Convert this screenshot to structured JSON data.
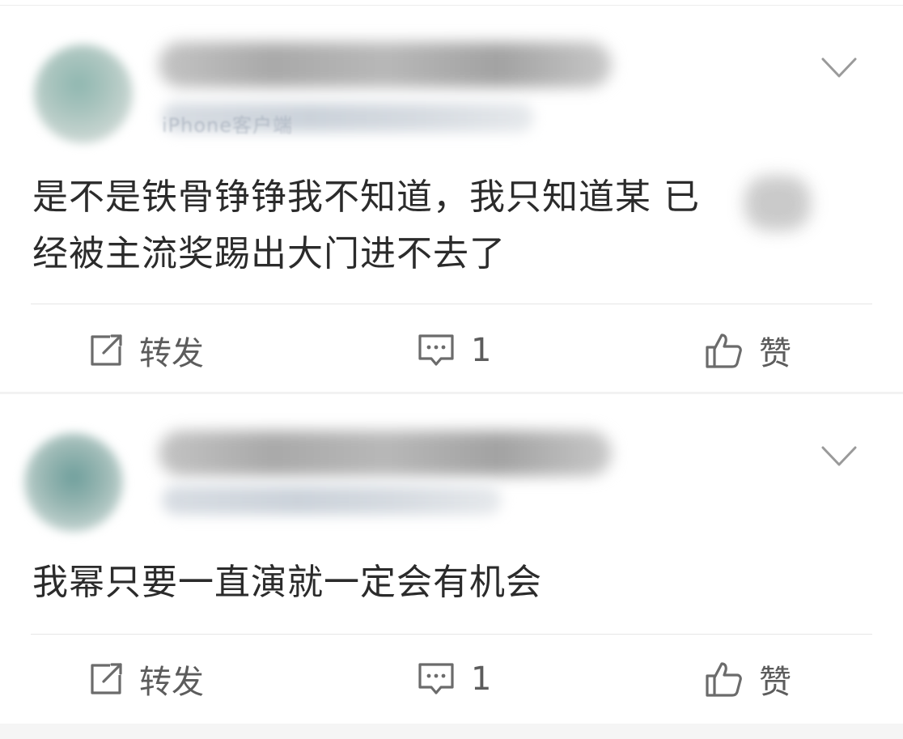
{
  "posts": [
    {
      "meta_visible_fragment": "iPhone客户端",
      "content": "是不是铁骨铮铮我不知道，我只知道某已经被主流奖踢出大门进不去了",
      "content_line1": "是不是铁骨铮铮我不知道，我只知道某  已",
      "content_line2": "经被主流奖踢出大门进不去了",
      "actions": {
        "share_label": "转发",
        "comment_count": "1",
        "like_label": "赞"
      }
    },
    {
      "content": "我幂只要一直演就一定会有机会",
      "actions": {
        "share_label": "转发",
        "comment_count": "1",
        "like_label": "赞"
      }
    }
  ],
  "icons": {
    "share": "share-icon",
    "comment": "comment-icon",
    "like": "thumbs-up-icon",
    "menu": "chevron-down-icon"
  },
  "colors": {
    "text": "#2b2b2b",
    "action_text": "#5c5c5c",
    "icon": "#6b6b6b",
    "divider": "#e6e6e6"
  }
}
